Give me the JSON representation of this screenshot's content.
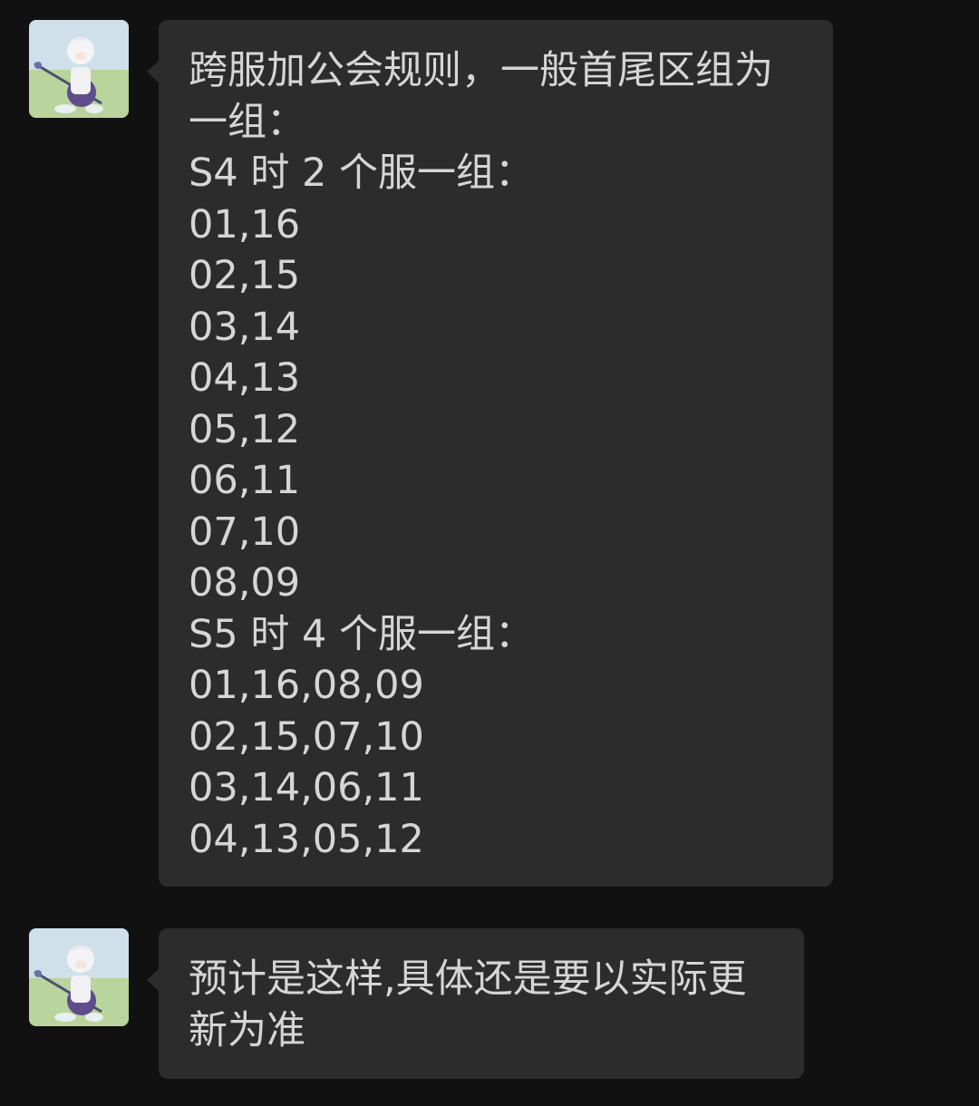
{
  "messages": [
    {
      "avatar_icon": "anime-character-avatar-icon",
      "lines": [
        "跨服加公会规则，一般首尾区组为",
        "一组：",
        "S4 时 2 个服一组：",
        "01,16",
        "02,15",
        "03,14",
        "04,13",
        "05,12",
        "06,11",
        "07,10",
        "08,09",
        "S5 时 4 个服一组：",
        "01,16,08,09",
        "02,15,07,10",
        "03,14,06,11",
        "04,13,05,12"
      ]
    },
    {
      "avatar_icon": "anime-character-avatar-icon",
      "lines": [
        "预计是这样,具体还是要以实际更",
        "新为准"
      ]
    }
  ],
  "colors": {
    "background": "#111111",
    "bubble": "#2c2c2c",
    "text": "#d6d6d6"
  }
}
